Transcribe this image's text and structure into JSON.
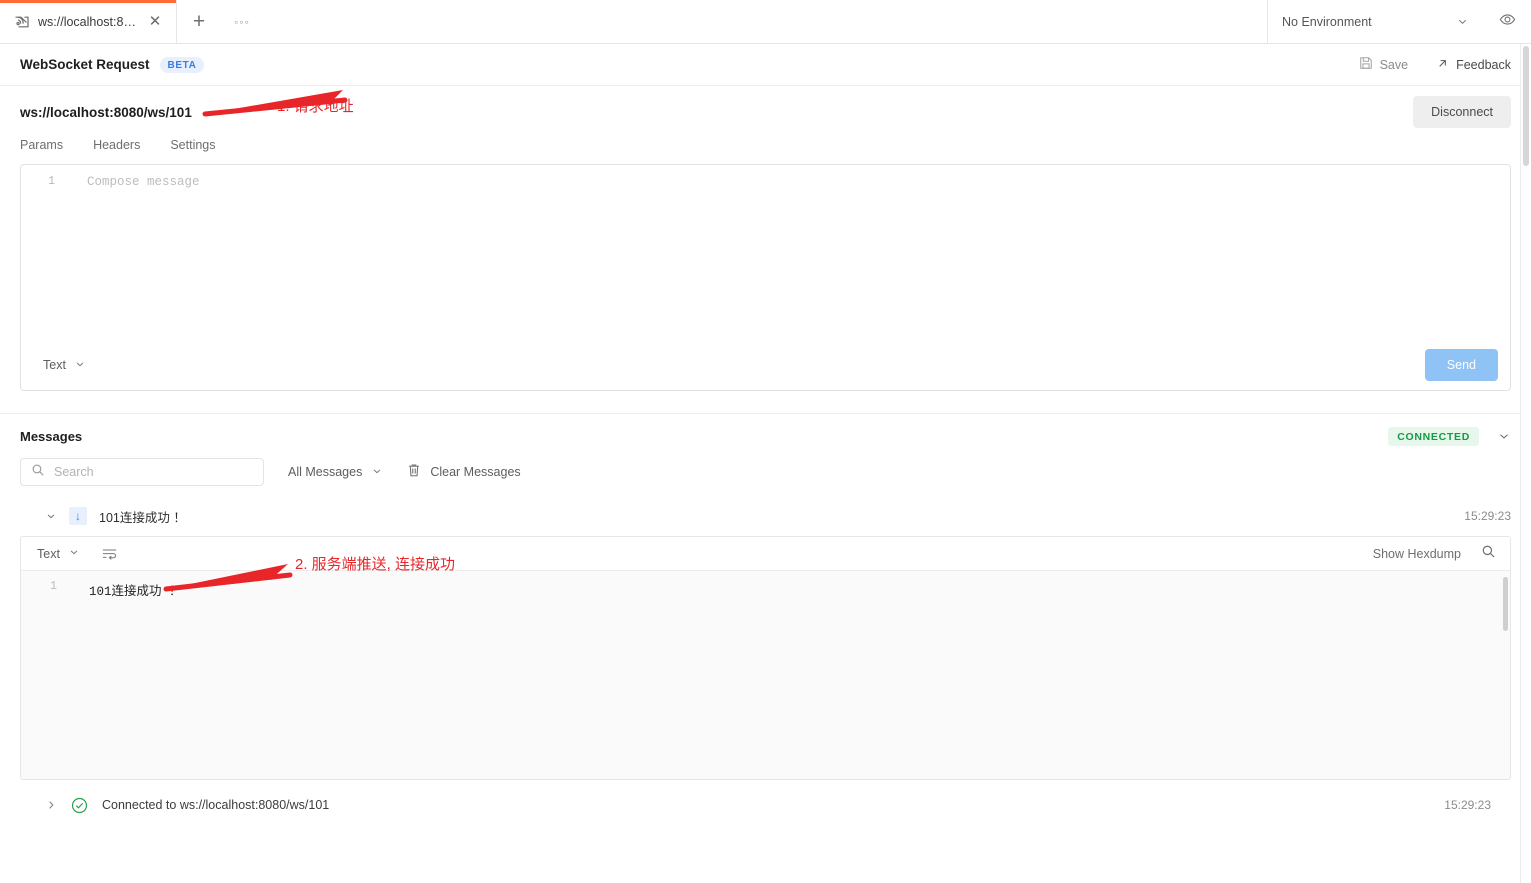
{
  "tabbar": {
    "tab": {
      "icon": "websocket-icon",
      "title": "ws://localhost:808...",
      "close": "✕"
    },
    "add_label": "+",
    "more_label": "◦◦◦",
    "environment": {
      "label": "No Environment",
      "caret": "chevron-down-icon",
      "eye": "eye-icon"
    }
  },
  "request": {
    "title": "WebSocket Request",
    "badge": "BETA",
    "save_label": "Save",
    "feedback_label": "Feedback",
    "url": "ws://localhost:8080/ws/101",
    "disconnect_label": "Disconnect",
    "tabs": [
      {
        "label": "Params",
        "active": false
      },
      {
        "label": "Headers",
        "active": false
      },
      {
        "label": "Settings",
        "active": false
      }
    ]
  },
  "compose": {
    "line_number": "1",
    "placeholder": "Compose message",
    "type_label": "Text",
    "send_label": "Send"
  },
  "messages": {
    "title": "Messages",
    "status_badge": "CONNECTED",
    "search_placeholder": "Search",
    "filter_label": "All Messages",
    "clear_label": "Clear Messages",
    "items": [
      {
        "direction": "received",
        "direction_glyph": "↓",
        "text": "101连接成功 ！",
        "time": "15:29:23"
      }
    ],
    "detail": {
      "type_label": "Text",
      "wrap_icon": "wrap-lines-icon",
      "hexdump_label": "Show Hexdump",
      "search_icon": "search-icon",
      "line_number": "1",
      "content": "101连接成功 ！"
    },
    "status": {
      "text": "Connected to ws://localhost:8080/ws/101",
      "time": "15:29:23"
    }
  },
  "annotations": [
    {
      "id": "annot-1",
      "text": "1. 请求地址",
      "color": "#e8262a"
    },
    {
      "id": "annot-2",
      "text": "2. 服务端推送, 连接成功",
      "color": "#e8262a"
    }
  ],
  "colors": {
    "tab_accent": "#ff6c37",
    "beta_badge_bg": "#e8f0fe",
    "beta_badge_fg": "#3b7dde",
    "connected_fg": "#159a46",
    "connected_bg": "#e7f7ec",
    "send_btn": "#8fc2f5",
    "annotation": "#e8262a"
  }
}
